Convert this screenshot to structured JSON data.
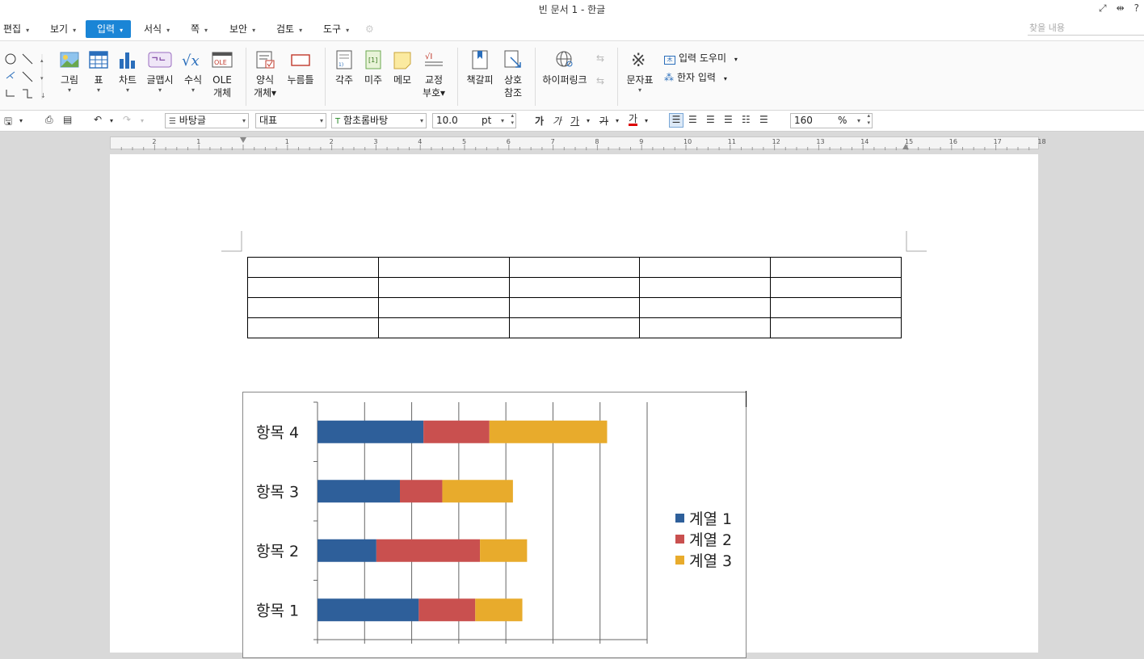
{
  "window": {
    "title": "빈 문서 1 - 한글"
  },
  "menu": [
    {
      "label": "편집"
    },
    {
      "label": "보기"
    },
    {
      "label": "입력"
    },
    {
      "label": "서식"
    },
    {
      "label": "쪽"
    },
    {
      "label": "보안"
    },
    {
      "label": "검토"
    },
    {
      "label": "도구"
    }
  ],
  "search": {
    "placeholder": "찾을 내용"
  },
  "ribbon": {
    "picture": "그림",
    "table": "표",
    "chart": "차트",
    "glyph": "글맵시",
    "formula": "수식",
    "ole1": "OLE",
    "ole2": "개체",
    "form1": "양식",
    "form2": "개체",
    "press": "누름틀",
    "footnote": "각주",
    "endnote": "미주",
    "memo": "메모",
    "proof1": "교정",
    "proof2": "부호",
    "bookmark": "책갈피",
    "xref1": "상호",
    "xref2": "참조",
    "hyperlink": "하이퍼링크",
    "symbols": "문자표",
    "input_helper": "입력 도우미",
    "hanja": "한자 입력"
  },
  "format": {
    "style": "바탕글",
    "lang": "대표",
    "font": "함초롬바탕",
    "size": "10.0",
    "size_unit": "pt",
    "zoom": "160",
    "zoom_unit": "%"
  },
  "icons": {
    "bold": "가",
    "italic": "가",
    "underline": "가",
    "strike": "가",
    "fontcolor": "가"
  },
  "ruler": [
    "2",
    "1",
    "1",
    "2",
    "3",
    "4",
    "5",
    "6",
    "7",
    "8",
    "9",
    "10",
    "11",
    "12",
    "13",
    "14",
    "15",
    "16",
    "17",
    "18"
  ],
  "chart_data": {
    "type": "bar",
    "orientation": "horizontal",
    "stacked": true,
    "categories": [
      "항목 1",
      "항목 2",
      "항목 3",
      "항목 4"
    ],
    "series": [
      {
        "name": "계열 1",
        "values": [
          4.3,
          2.5,
          3.5,
          4.5
        ],
        "color": "#2e5f9a"
      },
      {
        "name": "계열 2",
        "values": [
          2.4,
          4.4,
          1.8,
          2.8
        ],
        "color": "#c9504f"
      },
      {
        "name": "계열 3",
        "values": [
          2,
          2,
          3,
          5
        ],
        "color": "#e8ab2c"
      }
    ],
    "xlim": [
      0,
      14
    ],
    "grid": true,
    "legend": "right"
  },
  "colors": {
    "accent": "#1a85d6"
  }
}
